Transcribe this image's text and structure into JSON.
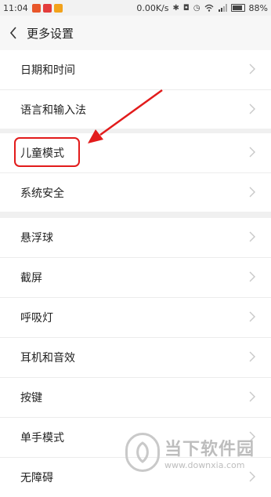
{
  "status_bar": {
    "time": "11:04",
    "net_speed": "0.00K/s",
    "battery": "88%",
    "battery_level": 0.88,
    "app_icon_colors": [
      "#e8562a",
      "#e33c3c",
      "#f2a21b"
    ]
  },
  "header": {
    "title": "更多设置",
    "back_icon": "chevron-left-icon"
  },
  "groups": [
    {
      "items": [
        {
          "label": "日期和时间"
        },
        {
          "label": "语言和输入法"
        }
      ]
    },
    {
      "items": [
        {
          "label": "儿童模式"
        },
        {
          "label": "系统安全"
        }
      ]
    },
    {
      "items": [
        {
          "label": "悬浮球"
        },
        {
          "label": "截屏"
        },
        {
          "label": "呼吸灯"
        },
        {
          "label": "耳机和音效"
        },
        {
          "label": "按键"
        },
        {
          "label": "单手模式"
        },
        {
          "label": "无障碍"
        }
      ]
    }
  ],
  "annotation": {
    "color": "#e21b1b",
    "highlighted_item": "儿童模式"
  },
  "watermark": {
    "title": "当下软件园",
    "url": "www.downxia.com"
  }
}
